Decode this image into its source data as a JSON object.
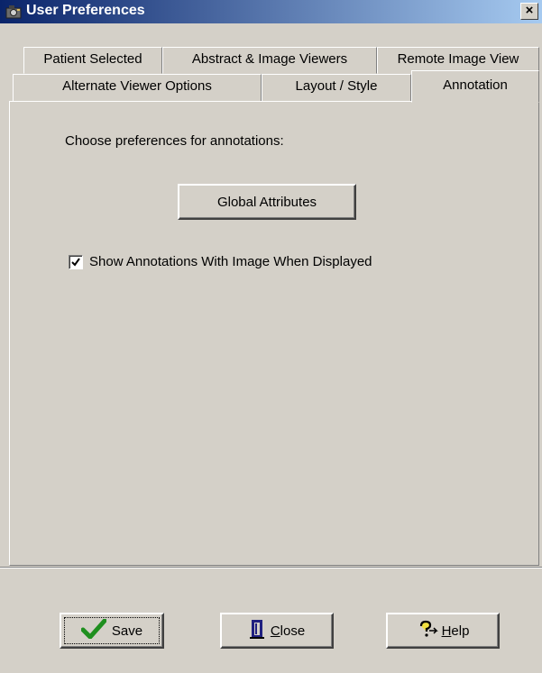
{
  "window": {
    "title": "User Preferences",
    "close_label": "×"
  },
  "tabs_row1": [
    {
      "label": "Patient Selected"
    },
    {
      "label": "Abstract & Image Viewers"
    },
    {
      "label": "Remote Image View"
    }
  ],
  "tabs_row2": [
    {
      "label": "Alternate Viewer Options"
    },
    {
      "label": "Layout / Style"
    },
    {
      "label": "Annotation",
      "active": true
    }
  ],
  "panel": {
    "prompt": "Choose preferences for annotations:",
    "global_attributes_button": "Global Attributes",
    "checkbox_label": "Show Annotations With Image When Displayed",
    "checkbox_checked": true
  },
  "footer": {
    "save_label": "Save",
    "close_label": "Close",
    "help_label": "Help",
    "close_mnemonic": "C",
    "close_rest": "lose",
    "help_mnemonic": "H",
    "help_rest": "elp"
  }
}
